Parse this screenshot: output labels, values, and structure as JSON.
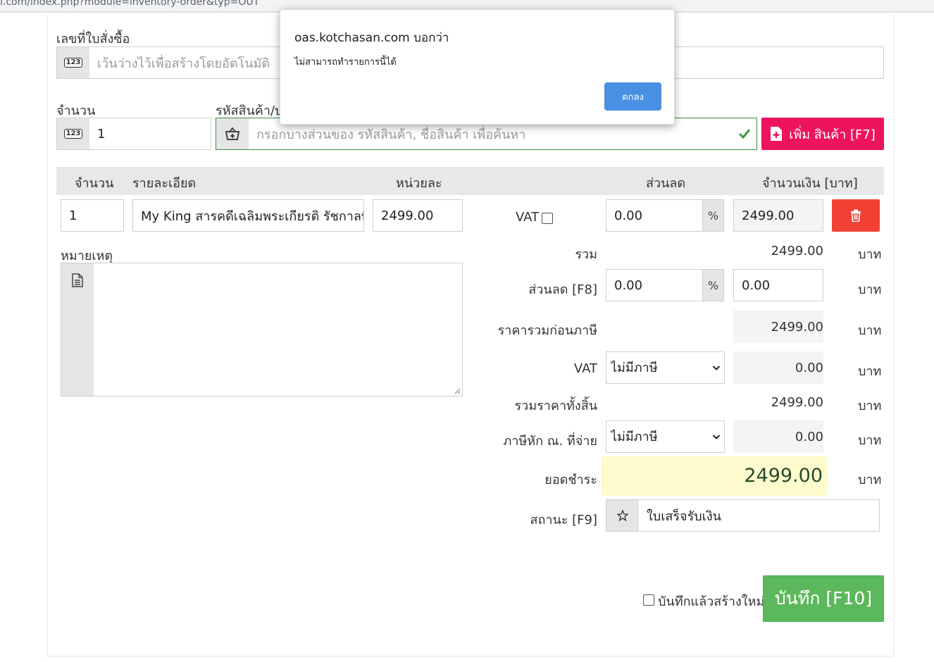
{
  "browser": {
    "url_fragment": "i.com/index.php?module=inventory-order&typ=OUT"
  },
  "dialog": {
    "title": "oas.kotchasan.com บอกว่า",
    "message": "ไม่สามารถทำรายการนี้ได้",
    "ok_label": "ตกลง",
    "accent_color": "#4a90e2"
  },
  "order_no": {
    "label": "เลขที่ใบสั่งซื้อ",
    "placeholder": "เว้นว่างไว้เพื่อสร้างโดยอัตโนมัติ",
    "icon": "number-icon"
  },
  "quantity": {
    "label": "จำนวน",
    "value": "1",
    "icon": "number-icon"
  },
  "product_search": {
    "label": "รหัสสินค้า/บ",
    "placeholder": "กรอกบางส่วนของ รหัสสินค้า, ชื่อสินค้า เพื่อค้นหา",
    "icon": "basket-add-icon",
    "valid_icon": "check-icon"
  },
  "add_product_button": {
    "label": "เพิ่ม สินค้า [F7]",
    "color": "#ec135f",
    "icon": "file-add-icon"
  },
  "table": {
    "headers": {
      "qty": "จำนวน",
      "detail": "รายละเอียด",
      "unit_price": "หน่วยละ",
      "discount": "ส่วนลด",
      "amount": "จำนวนเงิน [บาท]"
    },
    "row": {
      "qty": "1",
      "detail": "My King สารคดีเฉลิมพระเกียรติ รัชกาลที่",
      "unit_price": "2499.00",
      "vat_label": "VAT",
      "discount": "0.00",
      "discount_unit": "%",
      "amount": "2499.00",
      "delete_color": "#f04134"
    }
  },
  "note": {
    "label": "หมายเหตุ",
    "icon": "document-icon"
  },
  "summary": {
    "baht": "บาท",
    "subtotal_label": "รวม",
    "subtotal": "2499.00",
    "discount_label": "ส่วนลด [F8]",
    "discount_percent": "0.00",
    "discount_percent_unit": "%",
    "discount_amount": "0.00",
    "before_tax_label": "ราคารวมก่อนภาษี",
    "before_tax": "2499.00",
    "vat_label": "VAT",
    "vat_option": "ไม่มีภาษี",
    "vat_amount": "0.00",
    "grand_total_label": "รวมราคาทั้งสิ้น",
    "grand_total": "2499.00",
    "withholding_label": "ภาษีหัก ณ. ที่จ่าย",
    "withholding_option": "ไม่มีภาษี",
    "withholding_amount": "0.00",
    "payable_label": "ยอดชำระ",
    "payable": "2499.00",
    "payable_bg": "#fdfacd",
    "status_label": "สถานะ [F9]",
    "status_value": "ใบเสร็จรับเงิน",
    "status_icon": "star-icon"
  },
  "footer": {
    "save_new_label": "บันทึกแล้วสร้างใหม่",
    "save_label": "บันทึก [F10]",
    "save_color": "#5cb85c"
  }
}
